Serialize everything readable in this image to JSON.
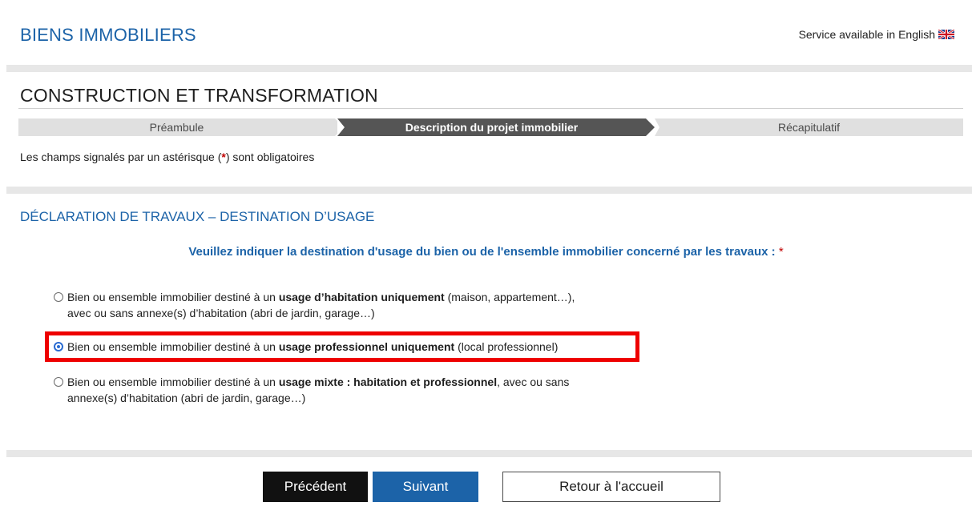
{
  "header": {
    "app_title": "BIENS IMMOBILIERS",
    "language_link": "Service available in English",
    "flag_icon": "uk-flag-icon"
  },
  "page": {
    "title": "CONSTRUCTION ET TRANSFORMATION"
  },
  "stepper": {
    "steps": [
      {
        "label": "Préambule",
        "active": false
      },
      {
        "label": "Description du projet immobilier",
        "active": true
      },
      {
        "label": "Récapitulatif",
        "active": false
      }
    ]
  },
  "mandatory_note": {
    "before": "Les champs signalés par un astérisque  (",
    "star": "*",
    "after": ")  sont obligatoires"
  },
  "section": {
    "title": "DÉCLARATION DE TRAVAUX – DESTINATION D’USAGE",
    "question": "Veuillez indiquer la destination d'usage du bien ou de l'ensemble immobilier concerné par les travaux :",
    "required_mark": "*"
  },
  "options": [
    {
      "prefix": "Bien ou ensemble immobilier destiné à un ",
      "bold": "usage d’habitation uniquement",
      "suffix": " (maison, appartement…),",
      "line2": "avec ou sans annexe(s) d’habitation (abri de jardin, garage…)",
      "checked": false
    },
    {
      "prefix": "Bien ou ensemble immobilier destiné à un ",
      "bold": "usage professionnel uniquement",
      "suffix": " (local professionnel)",
      "line2": "",
      "checked": true
    },
    {
      "prefix": "Bien ou ensemble immobilier destiné à un ",
      "bold": "usage mixte : habitation et professionnel",
      "suffix": ", avec ou sans",
      "line2": "annexe(s) d’habitation (abri de jardin, garage…)",
      "checked": false
    }
  ],
  "buttons": {
    "previous": "Précédent",
    "next": "Suivant",
    "home": "Retour à l'accueil"
  },
  "colors": {
    "accent": "#1c63a8",
    "highlight": "#ee0000",
    "required": "#c00000"
  }
}
